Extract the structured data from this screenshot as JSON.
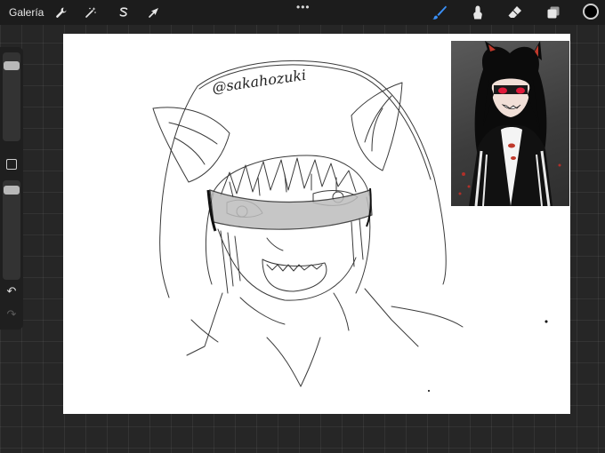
{
  "toolbar": {
    "gallery_label": "Galería",
    "left_tools": [
      "wrench-icon",
      "magic-wand-icon",
      "selection-icon",
      "transform-arrow-icon"
    ],
    "more_label": "•••",
    "right_tools": [
      "brush-icon",
      "smudge-icon",
      "eraser-icon",
      "layers-icon"
    ],
    "active_tool": "brush",
    "current_color": "#000000",
    "accent_color": "#3a8ff5"
  },
  "sidebar": {
    "brush_size_slider": "slider",
    "modify_button": "square-icon",
    "opacity_slider": "slider",
    "undo_label": "↶",
    "redo_label": "↷"
  },
  "canvas": {
    "watermark_text": "@sakahozuki"
  }
}
